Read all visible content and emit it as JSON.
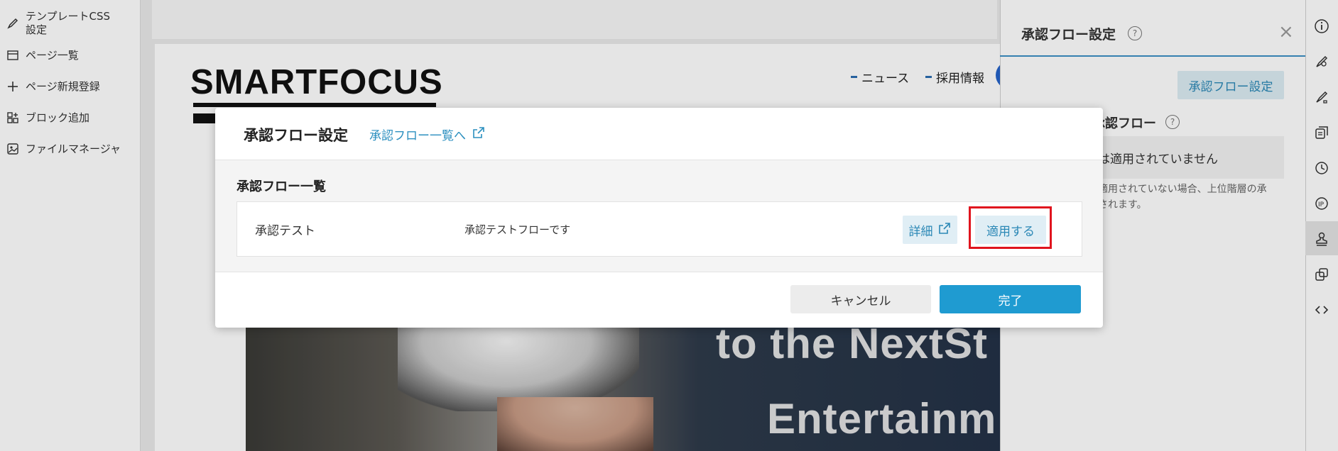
{
  "sidebar": {
    "items": [
      {
        "label": "テンプレートCSS",
        "label2": "設定",
        "icon": "brush-icon"
      },
      {
        "label": "ページ一覧",
        "icon": "window-icon"
      },
      {
        "label": "ページ新規登録",
        "icon": "plus-icon"
      },
      {
        "label": "ブロック追加",
        "icon": "blocks-icon"
      },
      {
        "label": "ファイルマネージャ",
        "icon": "image-file-icon"
      }
    ]
  },
  "preview": {
    "logo": "SMARTFOCUS",
    "nav": [
      "ニュース",
      "採用情報"
    ],
    "hero_lines": [
      "to the NextSt",
      "Entertainm"
    ]
  },
  "right_panel": {
    "title": "承認フロー設定",
    "help": "?",
    "close": "×",
    "button": "承認フロー設定",
    "subtitle": "承認フロー",
    "status": "は適用されていません",
    "note_line1": "適用されていない場合、上位階層の承",
    "note_line2": "されます。"
  },
  "toolbar": {
    "icons": [
      "info-icon",
      "brush-settings-icon",
      "paint-brush-icon",
      "copy-block-icon",
      "history-icon",
      "ip-icon",
      "approval-stamp-icon",
      "layers-icon",
      "code-icon"
    ],
    "active": "approval-stamp-icon"
  },
  "modal": {
    "title": "承認フロー設定",
    "link": "承認フロー一覧へ",
    "section_title": "承認フロー一覧",
    "rows": [
      {
        "name": "承認テスト",
        "description": "承認テストフローです",
        "detail_label": "詳細",
        "apply_label": "適用する"
      }
    ],
    "cancel_label": "キャンセル",
    "done_label": "完了"
  },
  "colors": {
    "accent": "#1f9bd1",
    "link": "#2b8fbf",
    "highlight": "#e0141e"
  }
}
